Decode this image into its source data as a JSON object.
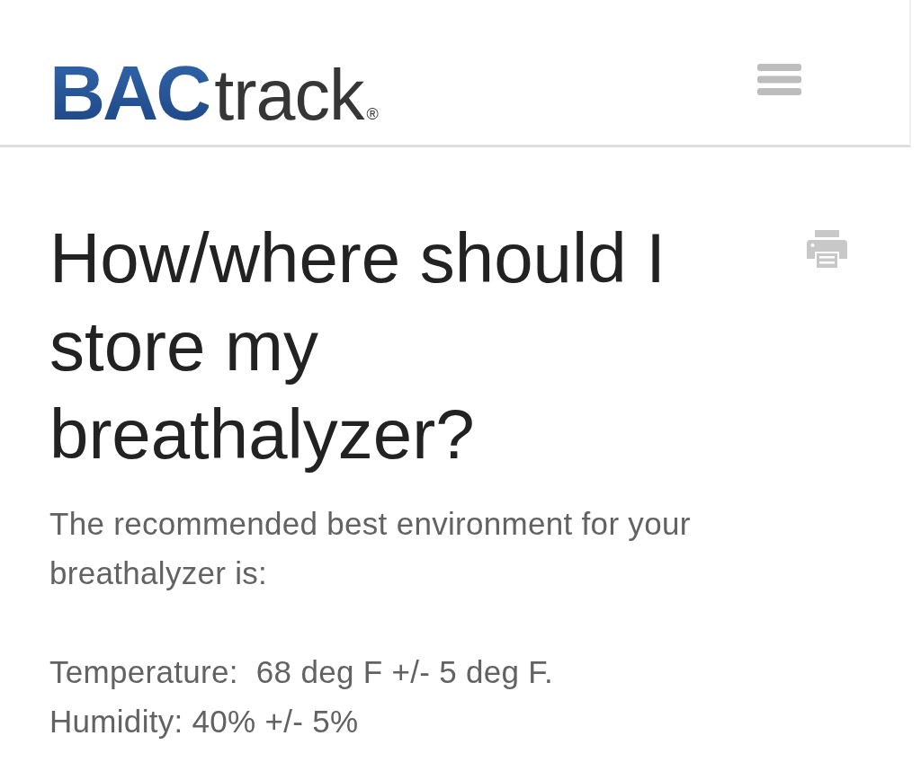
{
  "header": {
    "logo": {
      "initials": "BAC",
      "word": "track",
      "mark": "®"
    }
  },
  "article": {
    "title": "How/where should I store my breathalyzer?",
    "intro": "The recommended best environment for your breathalyzer is:",
    "specs": [
      "Temperature:  68 deg F +/- 5 deg F.",
      "Humidity: 40% +/- 5%"
    ]
  }
}
